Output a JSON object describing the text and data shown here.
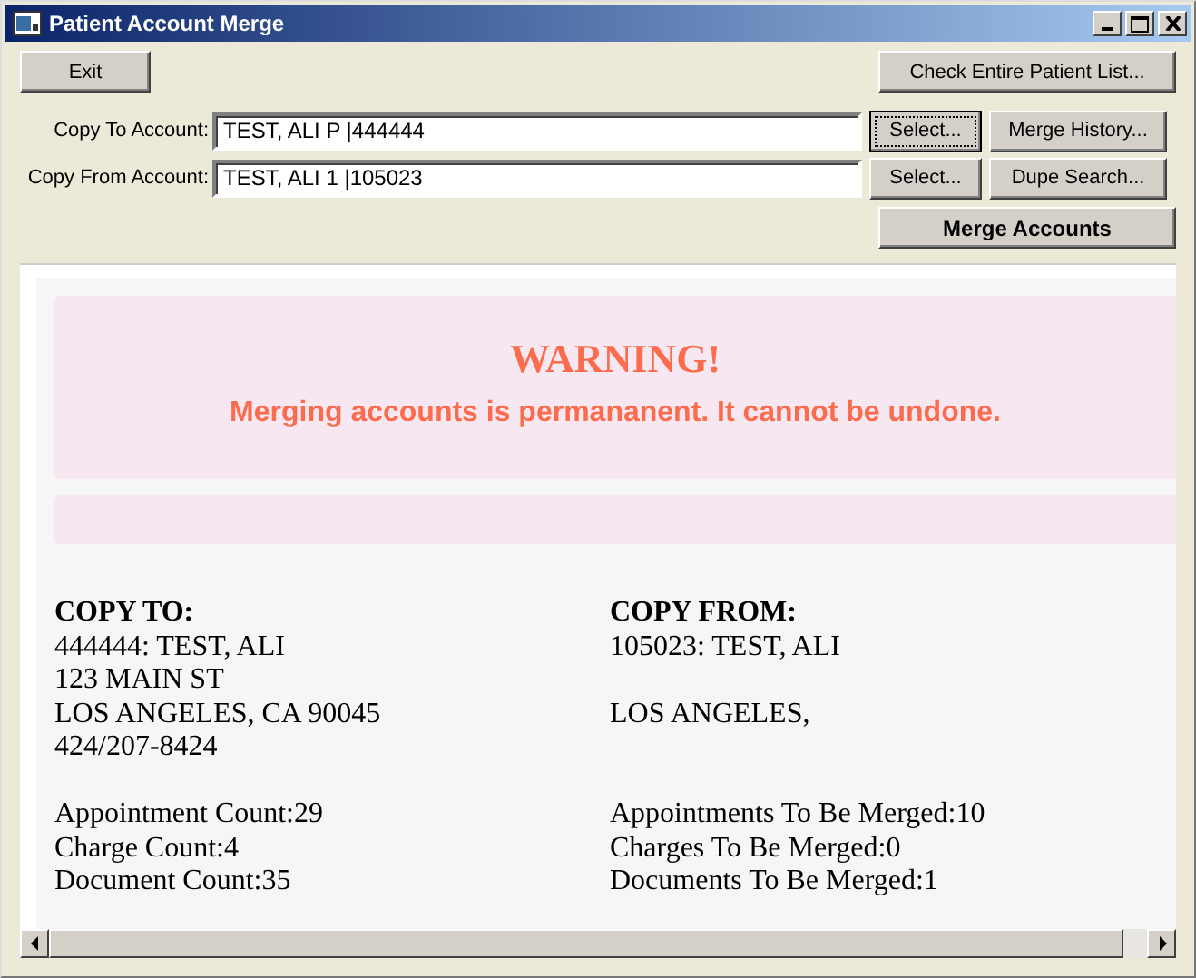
{
  "window": {
    "title": "Patient Account Merge"
  },
  "toolbar": {
    "exit": "Exit",
    "check": "Check Entire Patient List..."
  },
  "accounts": [
    {
      "label": "Copy To Account:",
      "value": "TEST, ALI P |444444",
      "select": "Select...",
      "select_focused": true,
      "extra": "Merge History..."
    },
    {
      "label": "Copy From Account:",
      "value": "TEST, ALI 1 |105023",
      "select": "Select...",
      "select_focused": false,
      "extra": "Dupe Search..."
    }
  ],
  "merge_button": "Merge Accounts",
  "warning": {
    "title": "WARNING!",
    "message": "Merging accounts is permananent. It cannot be undone."
  },
  "columns": [
    {
      "heading": "COPY TO:",
      "name": "444444: TEST, ALI",
      "street": "123 MAIN ST",
      "city": "LOS ANGELES, CA 90045",
      "phone": "424/207-8424",
      "counts": [
        "Appointment Count:29",
        "Charge Count:4",
        "Document Count:35"
      ]
    },
    {
      "heading": "COPY FROM:",
      "name": "105023: TEST, ALI",
      "city": "LOS ANGELES,",
      "counts": [
        "Appointments To Be Merged:10",
        "Charges To Be Merged:0",
        "Documents To Be Merged:1"
      ]
    }
  ]
}
